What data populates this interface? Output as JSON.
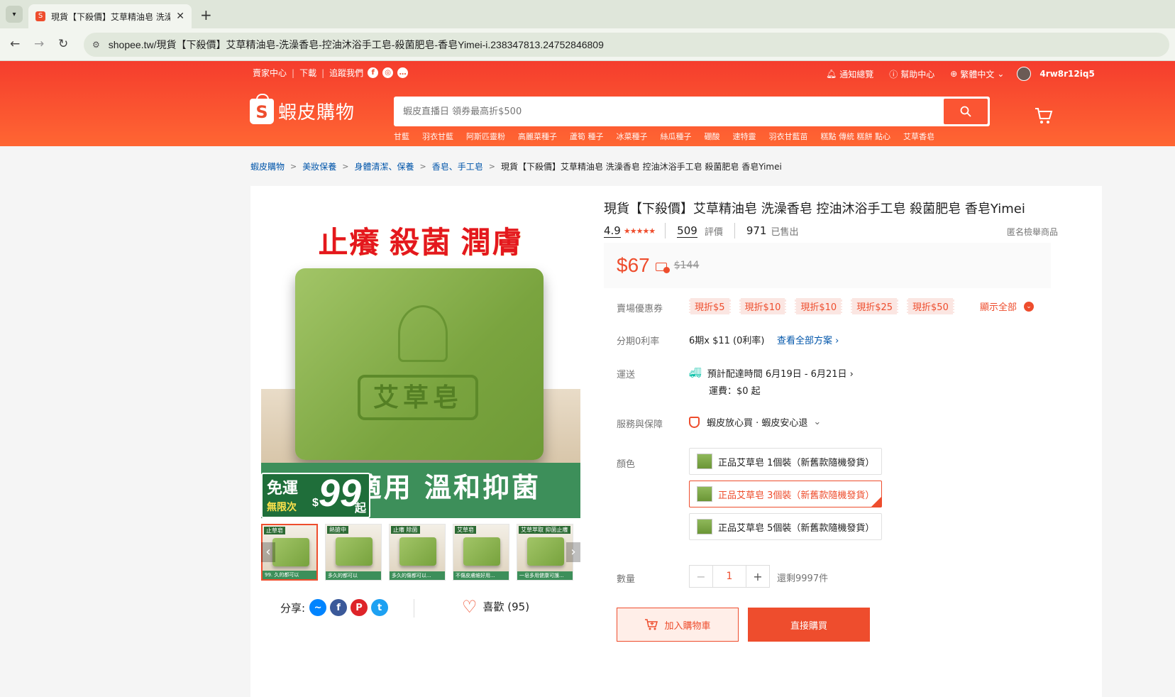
{
  "browser": {
    "tab_title": "現貨【下殺價】艾草精油皂 洗澡",
    "new_tab": "+",
    "url": "shopee.tw/現貨【下殺價】艾草精油皂-洗澡香皂-控油沐浴手工皂-殺菌肥皂-香皂Yimei-i.238347813.24752846809"
  },
  "topnav": {
    "seller": "賣家中心",
    "download": "下載",
    "follow": "追蹤我們",
    "notify": "通知總覽",
    "help": "幫助中心",
    "lang": "繁體中文",
    "user": "4rw8r12iq5"
  },
  "header": {
    "logo_text": "蝦皮購物",
    "search_placeholder": "蝦皮直播日 領券最高折$500",
    "hotwords": [
      "甘藍",
      "羽衣甘藍",
      "阿斯匹靈粉",
      "高麗菜種子",
      "蘆筍 種子",
      "冰菜種子",
      "絲瓜種子",
      "硼酸",
      "速特靈",
      "羽衣甘藍苗",
      "糕點 傳統 糕餅 點心",
      "艾草香皂"
    ]
  },
  "breadcrumb": [
    "蝦皮購物",
    "美妝保養",
    "身體清潔、保養",
    "香皂、手工皂"
  ],
  "breadcrumb_current": "現貨【下殺價】艾草精油皂 洗澡香皂 控油沐浴手工皂 殺菌肥皂 香皂Yimei",
  "gallery": {
    "headline": "止癢 殺菌 潤膚",
    "soap_text": "艾草皂",
    "banner": "適用 溫和抑菌",
    "promo_1": "免運",
    "promo_2": "無限次",
    "promo_3": "99",
    "promo_4": "起",
    "promo_dollar": "$",
    "thumbs": [
      {
        "tag": "止草皂",
        "bottom": "99. 久的都可以"
      },
      {
        "tag": "熱搶中",
        "bottom": "多久的都可以"
      },
      {
        "tag": "止癢 除菌",
        "bottom": "多久的傷都可以..."
      },
      {
        "tag": "艾草皂",
        "bottom": "不傷皮膚維好用..."
      },
      {
        "tag": "艾草萃取 抑菌止癢",
        "bottom": "一皂多用健康可護..."
      }
    ],
    "share_label": "分享:",
    "like_label": "喜歡 (95)"
  },
  "product": {
    "title": "現貨【下殺價】艾草精油皂 洗澡香皂 控油沐浴手工皂 殺菌肥皂 香皂Yimei",
    "rating": "4.9",
    "stars": "★★★★★",
    "reviews": "509",
    "reviews_label": "評價",
    "sold": "971",
    "sold_label": "已售出",
    "report": "匿名檢舉商品",
    "price": "$67",
    "old_price": "$144",
    "voucher_label": "賣場優惠券",
    "vouchers": [
      "現折$5",
      "現折$10",
      "現折$10",
      "現折$25",
      "現折$50"
    ],
    "show_all": "顯示全部",
    "installment_label": "分期0利率",
    "installment": "6期x $11 (0利率)",
    "installment_link": "查看全部方案 ›",
    "shipping_label": "運送",
    "shipping_eta": "預計配達時間 6月19日 - 6月21日 ›",
    "shipping_fee": "運費：$0 起",
    "service_label": "服務與保障",
    "service": "蝦皮放心買 · 蝦皮安心退",
    "color_label": "顏色",
    "variants": [
      "正品艾草皂 1個裝（新舊款隨機發貨）",
      "正品艾草皂 3個裝（新舊款隨機發貨）",
      "正品艾草皂 5個裝（新舊款隨機發貨）"
    ],
    "selected_variant": 1,
    "qty_label": "數量",
    "qty_minus": "−",
    "qty_value": "1",
    "qty_plus": "+",
    "stock": "還剩9997件",
    "add_cart": "加入購物車",
    "buy_now": "直接購買"
  },
  "colors": {
    "brand": "#ee4d2d",
    "link": "#0055aa"
  }
}
